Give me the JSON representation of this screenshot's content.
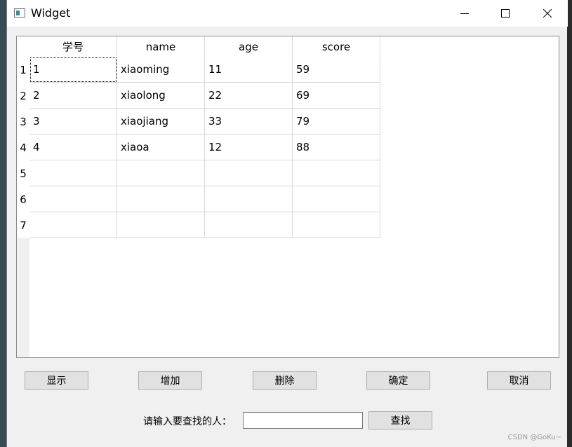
{
  "window": {
    "title": "Widget"
  },
  "window_controls": {
    "minimize_icon": "minimize-icon",
    "maximize_icon": "maximize-icon",
    "close_icon": "close-icon"
  },
  "table": {
    "headers": [
      "学号",
      "name",
      "age",
      "score"
    ],
    "row_numbers": [
      "1",
      "2",
      "3",
      "4",
      "5",
      "6",
      "7"
    ],
    "rows": [
      [
        "1",
        "xiaoming",
        "11",
        "59"
      ],
      [
        "2",
        "xiaolong",
        "22",
        "69"
      ],
      [
        "3",
        "xiaojiang",
        "33",
        "79"
      ],
      [
        "4",
        "xiaoa",
        "12",
        "88"
      ],
      [
        "",
        "",
        "",
        ""
      ],
      [
        "",
        "",
        "",
        ""
      ],
      [
        "",
        "",
        "",
        ""
      ]
    ]
  },
  "buttons": {
    "show": "显示",
    "add": "增加",
    "delete": "删除",
    "confirm": "确定",
    "cancel": "取消",
    "find": "查找"
  },
  "search": {
    "label": "请输入要查找的人：",
    "value": "",
    "placeholder": ""
  },
  "watermark": "CSDN @GoKu~",
  "colors": {
    "window_bg": "#f0f0f0",
    "button_bg": "#e1e1e1",
    "grid_line": "#d8d8d8"
  }
}
